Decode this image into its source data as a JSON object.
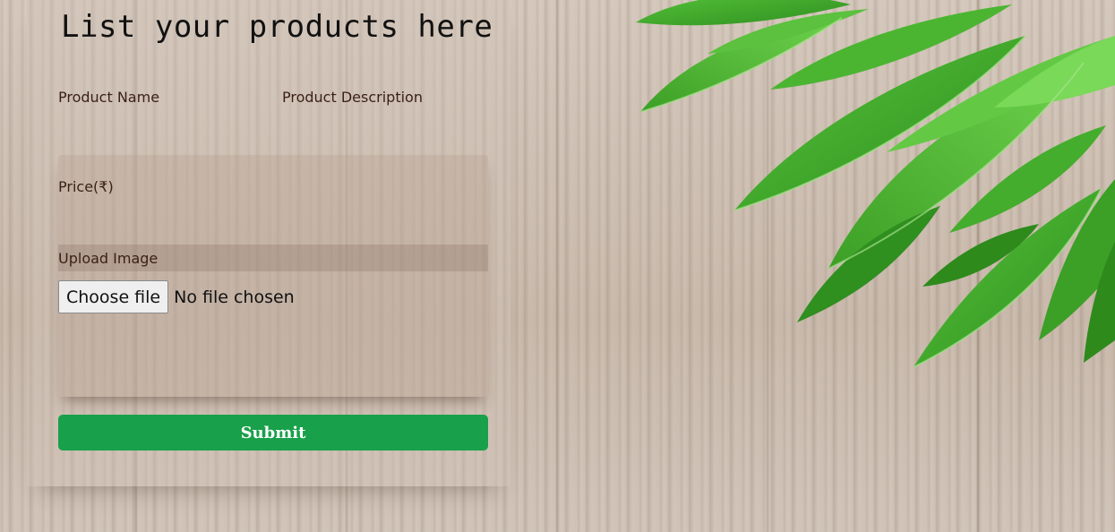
{
  "page": {
    "title": "List your products here"
  },
  "form": {
    "product_name_label": "Product Name",
    "product_description_label": "Product Description",
    "price_label": "Price(₹)",
    "upload_image_label": "Upload Image",
    "choose_file_label": "Choose file",
    "file_status": "No file chosen",
    "submit_label": "Submit"
  },
  "colors": {
    "submit_bg": "#19a04a",
    "label_text": "#3a1f16",
    "leaf_green": "#3fae2c"
  },
  "icons": {
    "decoration": "leaves-illustration"
  }
}
